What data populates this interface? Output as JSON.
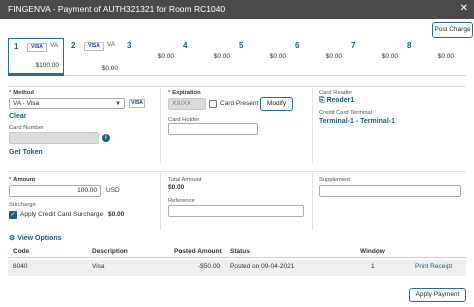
{
  "window": {
    "title": "FINGENVA - Payment of AUTH321321 for Room RC1040",
    "close_glyph": "✕"
  },
  "toolbar": {
    "post_charge_label": "Post Charge"
  },
  "windows": [
    {
      "num": "1",
      "card": "VISA",
      "label": "VA",
      "amount": "$100.00"
    },
    {
      "num": "2",
      "card": "VISA",
      "label": "VA",
      "amount": "$0.00"
    },
    {
      "num": "3",
      "card": "",
      "label": "",
      "amount": "$0.00"
    },
    {
      "num": "4",
      "card": "",
      "label": "",
      "amount": "$0.00"
    },
    {
      "num": "5",
      "card": "",
      "label": "",
      "amount": "$0.00"
    },
    {
      "num": "6",
      "card": "",
      "label": "",
      "amount": "$0.00"
    },
    {
      "num": "7",
      "card": "",
      "label": "",
      "amount": "$0.00"
    },
    {
      "num": "8",
      "card": "",
      "label": "",
      "amount": "$0.00"
    }
  ],
  "method": {
    "label": "Method",
    "value": "VA - Visa",
    "badge": "VISA",
    "clear_label": "Clear",
    "card_number_label": "Card Number",
    "card_number_value": "",
    "get_token_label": "Get Token",
    "info_glyph": "i"
  },
  "expiration": {
    "label": "Expiration",
    "placeholder": "XX/XX",
    "card_present_label": "Card Present",
    "modify_label": "Modify",
    "card_holder_label": "Card Holder",
    "card_holder_value": ""
  },
  "reader": {
    "card_reader_label": "Card Reader",
    "card_reader_value": "Reader1",
    "terminal_label": "Credit Card Terminal",
    "terminal_value": "Terminal-1 - Terminal-1"
  },
  "amount": {
    "label": "Amount",
    "value": "100.00",
    "currency": "USD",
    "surcharge_label": "Surcharge",
    "apply_surcharge_label": "Apply Credit Card Surcharge",
    "surcharge_value": "$0.00",
    "check_glyph": "✓"
  },
  "totals": {
    "total_amount_label": "Total Amount",
    "total_amount_value": "$0.00",
    "reference_label": "Reference",
    "reference_value": "",
    "supplement_label": "Supplement",
    "supplement_value": ""
  },
  "view_options_label": "View Options",
  "table": {
    "headers": [
      "Code",
      "Description",
      "Posted Amount",
      "Status",
      "Window"
    ],
    "rows": [
      {
        "code": "8040",
        "description": "Visa",
        "posted_amount": "-$50.00",
        "status": "Posted on 09-04-2021",
        "window": "1",
        "action": "Print Receipt"
      }
    ]
  },
  "footer": {
    "apply_payment_label": "Apply Payment"
  },
  "colors": {
    "accent": "#1d5f78",
    "titlebar": "#4a4a4a",
    "required": "#c0392b"
  }
}
